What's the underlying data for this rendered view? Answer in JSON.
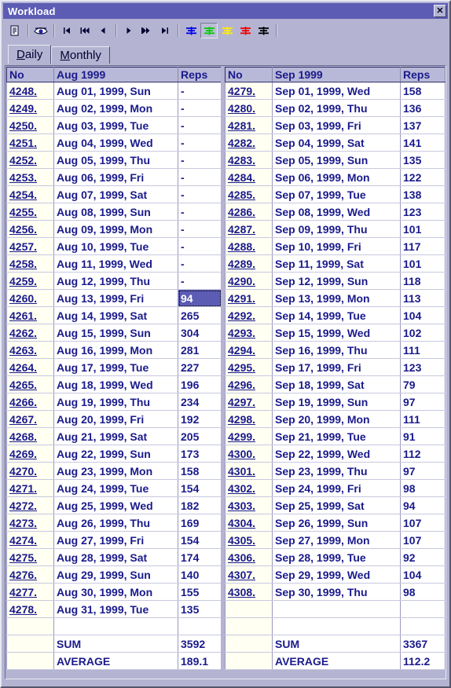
{
  "window": {
    "title": "Workload",
    "close_label": "✕"
  },
  "toolbar": {
    "buttons": [
      {
        "name": "report-list-icon",
        "kind": "list"
      },
      {
        "name": "preview-eye-icon",
        "kind": "eye"
      },
      {
        "name": "first-record-icon",
        "kind": "nav-first"
      },
      {
        "name": "previous-page-icon",
        "kind": "nav-prevpage"
      },
      {
        "name": "previous-record-icon",
        "kind": "nav-prev"
      },
      {
        "name": "next-record-icon",
        "kind": "nav-next"
      },
      {
        "name": "next-page-icon",
        "kind": "nav-nextpage"
      },
      {
        "name": "last-record-icon",
        "kind": "nav-last"
      },
      {
        "name": "blue-bars-icon",
        "kind": "bars",
        "color": "#0000ee",
        "pressed": false
      },
      {
        "name": "green-bars-icon",
        "kind": "bars",
        "color": "#00cc00",
        "pressed": true
      },
      {
        "name": "yellow-bars-icon",
        "kind": "bars",
        "color": "#ffee00",
        "pressed": false
      },
      {
        "name": "red-bars-icon",
        "kind": "bars",
        "color": "#ee0000",
        "pressed": false
      },
      {
        "name": "black-bars-icon",
        "kind": "bars",
        "color": "#000000",
        "pressed": false
      }
    ]
  },
  "tabs": [
    {
      "label": "Daily",
      "accel": "D",
      "active": true
    },
    {
      "label": "Monthly",
      "accel": "M",
      "active": false
    }
  ],
  "left_table": {
    "headers": [
      "No",
      "Aug 1999",
      "Reps"
    ],
    "rows": [
      [
        "4248.",
        "Aug 01, 1999, Sun",
        "-"
      ],
      [
        "4249.",
        "Aug 02, 1999, Mon",
        "-"
      ],
      [
        "4250.",
        "Aug 03, 1999, Tue",
        "-"
      ],
      [
        "4251.",
        "Aug 04, 1999, Wed",
        "-"
      ],
      [
        "4252.",
        "Aug 05, 1999, Thu",
        "-"
      ],
      [
        "4253.",
        "Aug 06, 1999, Fri",
        "-"
      ],
      [
        "4254.",
        "Aug 07, 1999, Sat",
        "-"
      ],
      [
        "4255.",
        "Aug 08, 1999, Sun",
        "-"
      ],
      [
        "4256.",
        "Aug 09, 1999, Mon",
        "-"
      ],
      [
        "4257.",
        "Aug 10, 1999, Tue",
        "-"
      ],
      [
        "4258.",
        "Aug 11, 1999, Wed",
        "-"
      ],
      [
        "4259.",
        "Aug 12, 1999, Thu",
        "-"
      ],
      [
        "4260.",
        "Aug 13, 1999, Fri",
        "94"
      ],
      [
        "4261.",
        "Aug 14, 1999, Sat",
        "265"
      ],
      [
        "4262.",
        "Aug 15, 1999, Sun",
        "304"
      ],
      [
        "4263.",
        "Aug 16, 1999, Mon",
        "281"
      ],
      [
        "4264.",
        "Aug 17, 1999, Tue",
        "227"
      ],
      [
        "4265.",
        "Aug 18, 1999, Wed",
        "196"
      ],
      [
        "4266.",
        "Aug 19, 1999, Thu",
        "234"
      ],
      [
        "4267.",
        "Aug 20, 1999, Fri",
        "192"
      ],
      [
        "4268.",
        "Aug 21, 1999, Sat",
        "205"
      ],
      [
        "4269.",
        "Aug 22, 1999, Sun",
        "173"
      ],
      [
        "4270.",
        "Aug 23, 1999, Mon",
        "158"
      ],
      [
        "4271.",
        "Aug 24, 1999, Tue",
        "154"
      ],
      [
        "4272.",
        "Aug 25, 1999, Wed",
        "182"
      ],
      [
        "4273.",
        "Aug 26, 1999, Thu",
        "169"
      ],
      [
        "4274.",
        "Aug 27, 1999, Fri",
        "154"
      ],
      [
        "4275.",
        "Aug 28, 1999, Sat",
        "174"
      ],
      [
        "4276.",
        "Aug 29, 1999, Sun",
        "140"
      ],
      [
        "4277.",
        "Aug 30, 1999, Mon",
        "155"
      ],
      [
        "4278.",
        "Aug 31, 1999, Tue",
        "135"
      ]
    ],
    "selected_cell": {
      "row": 12,
      "col": 2
    },
    "summary": [
      {
        "label": "SUM",
        "value": "3592"
      },
      {
        "label": "AVERAGE",
        "value": "189.1"
      }
    ]
  },
  "right_table": {
    "headers": [
      "No",
      "Sep 1999",
      "Reps"
    ],
    "rows": [
      [
        "4279.",
        "Sep 01, 1999, Wed",
        "158"
      ],
      [
        "4280.",
        "Sep 02, 1999, Thu",
        "136"
      ],
      [
        "4281.",
        "Sep 03, 1999, Fri",
        "137"
      ],
      [
        "4282.",
        "Sep 04, 1999, Sat",
        "141"
      ],
      [
        "4283.",
        "Sep 05, 1999, Sun",
        "135"
      ],
      [
        "4284.",
        "Sep 06, 1999, Mon",
        "122"
      ],
      [
        "4285.",
        "Sep 07, 1999, Tue",
        "138"
      ],
      [
        "4286.",
        "Sep 08, 1999, Wed",
        "123"
      ],
      [
        "4287.",
        "Sep 09, 1999, Thu",
        "101"
      ],
      [
        "4288.",
        "Sep 10, 1999, Fri",
        "117"
      ],
      [
        "4289.",
        "Sep 11, 1999, Sat",
        "101"
      ],
      [
        "4290.",
        "Sep 12, 1999, Sun",
        "118"
      ],
      [
        "4291.",
        "Sep 13, 1999, Mon",
        "113"
      ],
      [
        "4292.",
        "Sep 14, 1999, Tue",
        "104"
      ],
      [
        "4293.",
        "Sep 15, 1999, Wed",
        "102"
      ],
      [
        "4294.",
        "Sep 16, 1999, Thu",
        "111"
      ],
      [
        "4295.",
        "Sep 17, 1999, Fri",
        "123"
      ],
      [
        "4296.",
        "Sep 18, 1999, Sat",
        "79"
      ],
      [
        "4297.",
        "Sep 19, 1999, Sun",
        "97"
      ],
      [
        "4298.",
        "Sep 20, 1999, Mon",
        "111"
      ],
      [
        "4299.",
        "Sep 21, 1999, Tue",
        "91"
      ],
      [
        "4300.",
        "Sep 22, 1999, Wed",
        "112"
      ],
      [
        "4301.",
        "Sep 23, 1999, Thu",
        "97"
      ],
      [
        "4302.",
        "Sep 24, 1999, Fri",
        "98"
      ],
      [
        "4303.",
        "Sep 25, 1999, Sat",
        "94"
      ],
      [
        "4304.",
        "Sep 26, 1999, Sun",
        "107"
      ],
      [
        "4305.",
        "Sep 27, 1999, Mon",
        "107"
      ],
      [
        "4306.",
        "Sep 28, 1999, Tue",
        "92"
      ],
      [
        "4307.",
        "Sep 29, 1999, Wed",
        "104"
      ],
      [
        "4308.",
        "Sep 30, 1999, Thu",
        "98"
      ],
      [
        "",
        "",
        ""
      ]
    ],
    "selected_cell": null,
    "summary": [
      {
        "label": "SUM",
        "value": "3367"
      },
      {
        "label": "AVERAGE",
        "value": "112.2"
      }
    ]
  },
  "colors": {
    "title_bar": "#5c5cb4",
    "window_face": "#b4b4d2",
    "grid_text": "#1a1a8c",
    "selection": "#5c5cb4"
  }
}
